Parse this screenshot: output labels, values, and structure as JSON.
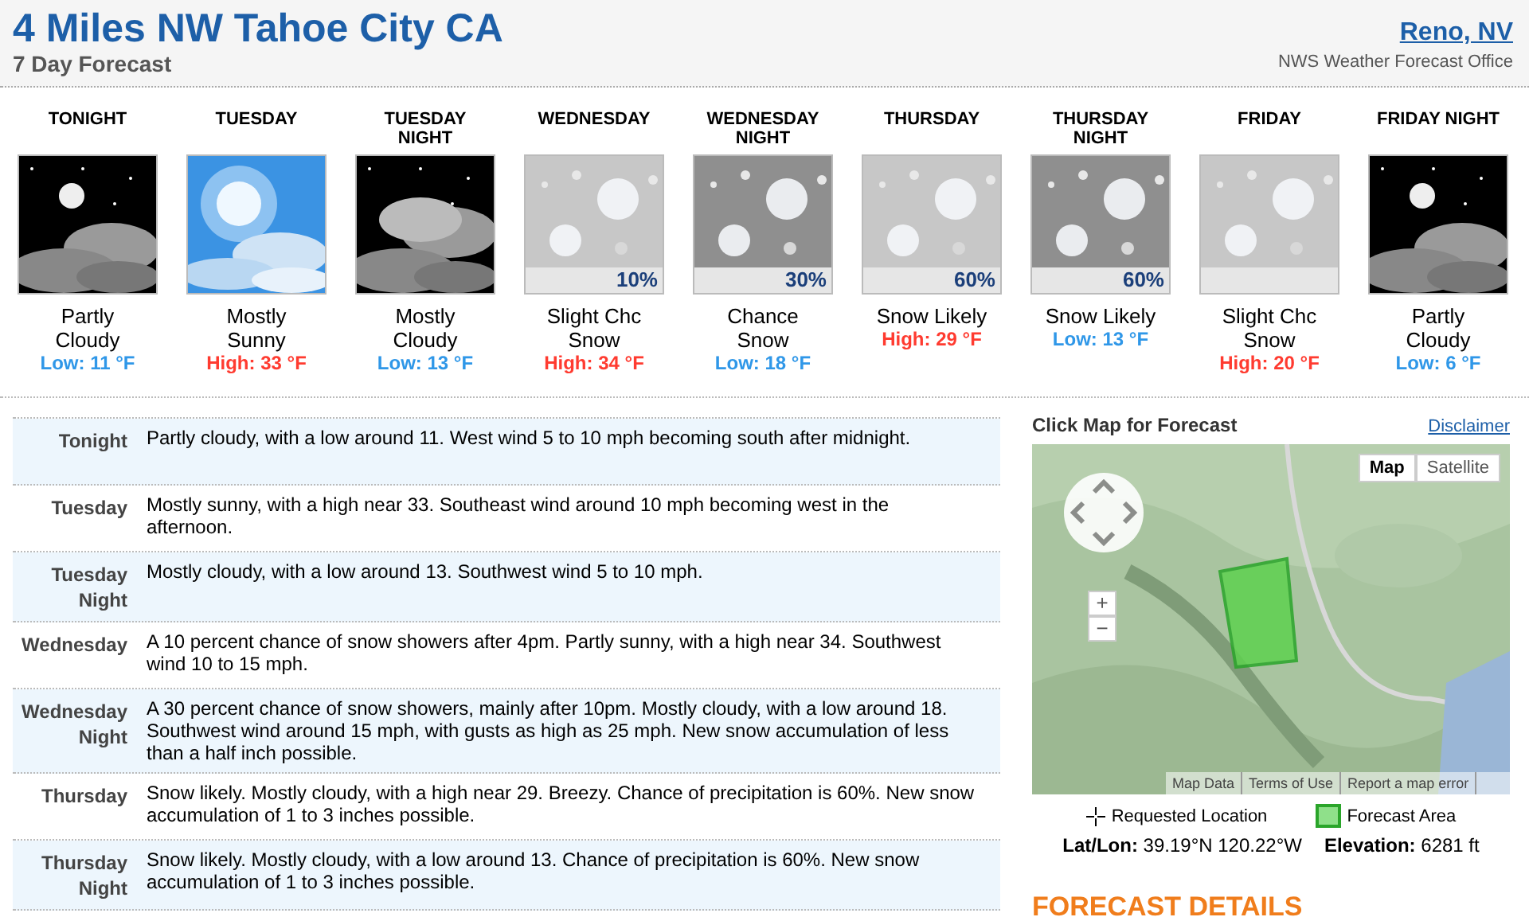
{
  "header": {
    "title": "4 Miles NW Tahoe City CA",
    "subtitle": "7 Day Forecast",
    "office_link": "Reno, NV",
    "office_label": "NWS Weather Forecast Office"
  },
  "periods": [
    {
      "name": "TONIGHT",
      "kind": "night",
      "summary": "Partly Cloudy",
      "temp": {
        "text": "Low: 11 °F",
        "kind": "low"
      }
    },
    {
      "name": "TUESDAY",
      "kind": "sunny",
      "summary": "Mostly Sunny",
      "temp": {
        "text": "High: 33 °F",
        "kind": "high"
      }
    },
    {
      "name": "TUESDAY NIGHT",
      "kind": "overcast",
      "summary": "Mostly Cloudy",
      "temp": {
        "text": "Low: 13 °F",
        "kind": "low"
      }
    },
    {
      "name": "WEDNESDAY",
      "kind": "snow",
      "chance": "10%",
      "summary": "Slight Chc Snow",
      "temp": {
        "text": "High: 34 °F",
        "kind": "high"
      }
    },
    {
      "name": "WEDNESDAY NIGHT",
      "kind": "darksnow",
      "chance": "30%",
      "summary": "Chance Snow",
      "temp": {
        "text": "Low: 18 °F",
        "kind": "low"
      }
    },
    {
      "name": "THURSDAY",
      "kind": "snow",
      "chance": "60%",
      "summary": "Snow Likely",
      "temp": {
        "text": "High: 29 °F",
        "kind": "high"
      }
    },
    {
      "name": "THURSDAY NIGHT",
      "kind": "darksnow",
      "chance": "60%",
      "summary": "Snow Likely",
      "temp": {
        "text": "Low: 13 °F",
        "kind": "low"
      }
    },
    {
      "name": "FRIDAY",
      "kind": "snow",
      "summary": "Slight Chc Snow",
      "temp": {
        "text": "High: 20 °F",
        "kind": "high"
      }
    },
    {
      "name": "FRIDAY NIGHT",
      "kind": "night",
      "summary": "Partly Cloudy",
      "temp": {
        "text": "Low: 6 °F",
        "kind": "low"
      }
    }
  ],
  "detailed": [
    {
      "label": "Tonight",
      "text": "Partly cloudy, with a low around 11. West wind 5 to 10 mph becoming south after midnight."
    },
    {
      "label": "Tuesday",
      "text": "Mostly sunny, with a high near 33. Southeast wind around 10 mph becoming west in the afternoon."
    },
    {
      "label": "Tuesday Night",
      "text": "Mostly cloudy, with a low around 13. Southwest wind 5 to 10 mph."
    },
    {
      "label": "Wednesday",
      "text": "A 10 percent chance of snow showers after 4pm. Partly sunny, with a high near 34. Southwest wind 10 to 15 mph."
    },
    {
      "label": "Wednesday Night",
      "text": "A 30 percent chance of snow showers, mainly after 10pm. Mostly cloudy, with a low around 18. Southwest wind around 15 mph, with gusts as high as 25 mph. New snow accumulation of less than a half inch possible."
    },
    {
      "label": "Thursday",
      "text": "Snow likely. Mostly cloudy, with a high near 29. Breezy. Chance of precipitation is 60%. New snow accumulation of 1 to 3 inches possible."
    },
    {
      "label": "Thursday Night",
      "text": "Snow likely. Mostly cloudy, with a low around 13. Chance of precipitation is 60%. New snow accumulation of 1 to 3 inches possible."
    }
  ],
  "map_panel": {
    "title": "Click Map for Forecast",
    "disclaimer": "Disclaimer",
    "map_types": [
      {
        "label": "Map",
        "selected": true
      },
      {
        "label": "Satellite",
        "selected": false
      }
    ],
    "zoom_in": "+",
    "zoom_out": "−",
    "footer_links": [
      "Map Data",
      "Terms of Use",
      "Report a map error"
    ],
    "legend": [
      "Requested Location",
      "Forecast Area"
    ],
    "latlon_label": "Lat/Lon:",
    "latlon": "39.19°N 120.22°W",
    "elevation_label": "Elevation:",
    "elevation": "6281 ft"
  },
  "details_heading": "FORECAST DETAILS"
}
